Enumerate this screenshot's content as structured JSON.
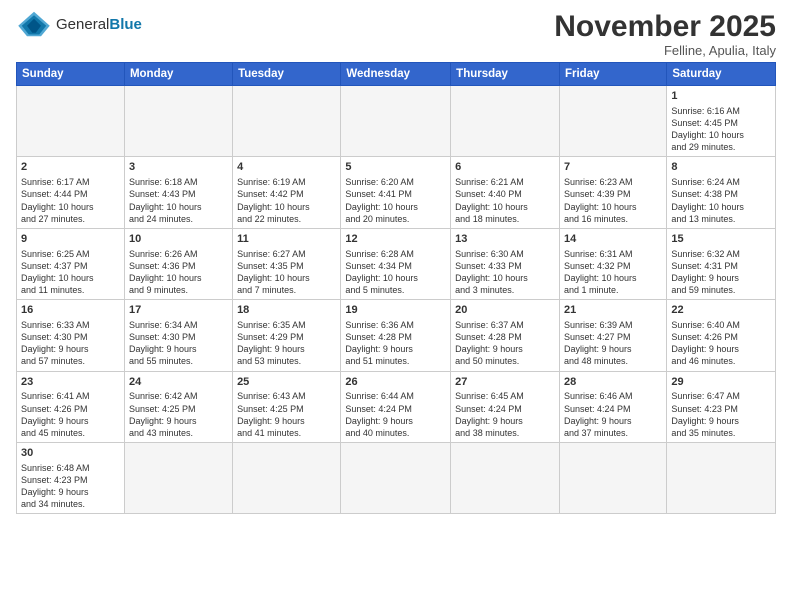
{
  "logo": {
    "text_general": "General",
    "text_blue": "Blue"
  },
  "header": {
    "month": "November 2025",
    "location": "Felline, Apulia, Italy"
  },
  "weekdays": [
    "Sunday",
    "Monday",
    "Tuesday",
    "Wednesday",
    "Thursday",
    "Friday",
    "Saturday"
  ],
  "weeks": [
    [
      {
        "day": "",
        "info": "",
        "empty": true
      },
      {
        "day": "",
        "info": "",
        "empty": true
      },
      {
        "day": "",
        "info": "",
        "empty": true
      },
      {
        "day": "",
        "info": "",
        "empty": true
      },
      {
        "day": "",
        "info": "",
        "empty": true
      },
      {
        "day": "",
        "info": "",
        "empty": true
      },
      {
        "day": "1",
        "info": "Sunrise: 6:16 AM\nSunset: 4:45 PM\nDaylight: 10 hours\nand 29 minutes.",
        "empty": false
      }
    ],
    [
      {
        "day": "2",
        "info": "Sunrise: 6:17 AM\nSunset: 4:44 PM\nDaylight: 10 hours\nand 27 minutes.",
        "empty": false
      },
      {
        "day": "3",
        "info": "Sunrise: 6:18 AM\nSunset: 4:43 PM\nDaylight: 10 hours\nand 24 minutes.",
        "empty": false
      },
      {
        "day": "4",
        "info": "Sunrise: 6:19 AM\nSunset: 4:42 PM\nDaylight: 10 hours\nand 22 minutes.",
        "empty": false
      },
      {
        "day": "5",
        "info": "Sunrise: 6:20 AM\nSunset: 4:41 PM\nDaylight: 10 hours\nand 20 minutes.",
        "empty": false
      },
      {
        "day": "6",
        "info": "Sunrise: 6:21 AM\nSunset: 4:40 PM\nDaylight: 10 hours\nand 18 minutes.",
        "empty": false
      },
      {
        "day": "7",
        "info": "Sunrise: 6:23 AM\nSunset: 4:39 PM\nDaylight: 10 hours\nand 16 minutes.",
        "empty": false
      },
      {
        "day": "8",
        "info": "Sunrise: 6:24 AM\nSunset: 4:38 PM\nDaylight: 10 hours\nand 13 minutes.",
        "empty": false
      }
    ],
    [
      {
        "day": "9",
        "info": "Sunrise: 6:25 AM\nSunset: 4:37 PM\nDaylight: 10 hours\nand 11 minutes.",
        "empty": false
      },
      {
        "day": "10",
        "info": "Sunrise: 6:26 AM\nSunset: 4:36 PM\nDaylight: 10 hours\nand 9 minutes.",
        "empty": false
      },
      {
        "day": "11",
        "info": "Sunrise: 6:27 AM\nSunset: 4:35 PM\nDaylight: 10 hours\nand 7 minutes.",
        "empty": false
      },
      {
        "day": "12",
        "info": "Sunrise: 6:28 AM\nSunset: 4:34 PM\nDaylight: 10 hours\nand 5 minutes.",
        "empty": false
      },
      {
        "day": "13",
        "info": "Sunrise: 6:30 AM\nSunset: 4:33 PM\nDaylight: 10 hours\nand 3 minutes.",
        "empty": false
      },
      {
        "day": "14",
        "info": "Sunrise: 6:31 AM\nSunset: 4:32 PM\nDaylight: 10 hours\nand 1 minute.",
        "empty": false
      },
      {
        "day": "15",
        "info": "Sunrise: 6:32 AM\nSunset: 4:31 PM\nDaylight: 9 hours\nand 59 minutes.",
        "empty": false
      }
    ],
    [
      {
        "day": "16",
        "info": "Sunrise: 6:33 AM\nSunset: 4:30 PM\nDaylight: 9 hours\nand 57 minutes.",
        "empty": false
      },
      {
        "day": "17",
        "info": "Sunrise: 6:34 AM\nSunset: 4:30 PM\nDaylight: 9 hours\nand 55 minutes.",
        "empty": false
      },
      {
        "day": "18",
        "info": "Sunrise: 6:35 AM\nSunset: 4:29 PM\nDaylight: 9 hours\nand 53 minutes.",
        "empty": false
      },
      {
        "day": "19",
        "info": "Sunrise: 6:36 AM\nSunset: 4:28 PM\nDaylight: 9 hours\nand 51 minutes.",
        "empty": false
      },
      {
        "day": "20",
        "info": "Sunrise: 6:37 AM\nSunset: 4:28 PM\nDaylight: 9 hours\nand 50 minutes.",
        "empty": false
      },
      {
        "day": "21",
        "info": "Sunrise: 6:39 AM\nSunset: 4:27 PM\nDaylight: 9 hours\nand 48 minutes.",
        "empty": false
      },
      {
        "day": "22",
        "info": "Sunrise: 6:40 AM\nSunset: 4:26 PM\nDaylight: 9 hours\nand 46 minutes.",
        "empty": false
      }
    ],
    [
      {
        "day": "23",
        "info": "Sunrise: 6:41 AM\nSunset: 4:26 PM\nDaylight: 9 hours\nand 45 minutes.",
        "empty": false
      },
      {
        "day": "24",
        "info": "Sunrise: 6:42 AM\nSunset: 4:25 PM\nDaylight: 9 hours\nand 43 minutes.",
        "empty": false
      },
      {
        "day": "25",
        "info": "Sunrise: 6:43 AM\nSunset: 4:25 PM\nDaylight: 9 hours\nand 41 minutes.",
        "empty": false
      },
      {
        "day": "26",
        "info": "Sunrise: 6:44 AM\nSunset: 4:24 PM\nDaylight: 9 hours\nand 40 minutes.",
        "empty": false
      },
      {
        "day": "27",
        "info": "Sunrise: 6:45 AM\nSunset: 4:24 PM\nDaylight: 9 hours\nand 38 minutes.",
        "empty": false
      },
      {
        "day": "28",
        "info": "Sunrise: 6:46 AM\nSunset: 4:24 PM\nDaylight: 9 hours\nand 37 minutes.",
        "empty": false
      },
      {
        "day": "29",
        "info": "Sunrise: 6:47 AM\nSunset: 4:23 PM\nDaylight: 9 hours\nand 35 minutes.",
        "empty": false
      }
    ],
    [
      {
        "day": "30",
        "info": "Sunrise: 6:48 AM\nSunset: 4:23 PM\nDaylight: 9 hours\nand 34 minutes.",
        "empty": false
      },
      {
        "day": "",
        "info": "",
        "empty": true
      },
      {
        "day": "",
        "info": "",
        "empty": true
      },
      {
        "day": "",
        "info": "",
        "empty": true
      },
      {
        "day": "",
        "info": "",
        "empty": true
      },
      {
        "day": "",
        "info": "",
        "empty": true
      },
      {
        "day": "",
        "info": "",
        "empty": true
      }
    ]
  ]
}
